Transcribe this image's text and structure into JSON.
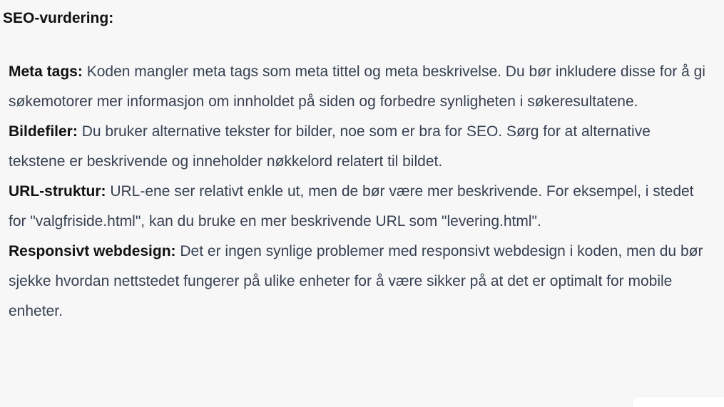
{
  "heading": "SEO-vurdering:",
  "items": [
    {
      "title": "Meta tags:",
      "text": "Koden mangler meta tags som meta tittel og meta beskrivelse. Du bør inkludere disse for å gi søkemotorer mer informasjon om innholdet på siden og forbedre synligheten i søkeresultatene."
    },
    {
      "title": "Bildefiler:",
      "text": "Du bruker alternative tekster for bilder, noe som er bra for SEO. Sørg for at alternative tekstene er beskrivende og inneholder nøkkelord relatert til bildet."
    },
    {
      "title": "URL-struktur:",
      "text": "URL-ene ser relativt enkle ut, men de bør være mer beskrivende. For eksempel, i stedet for \"valgfriside.html\", kan du bruke en mer beskrivende URL som \"levering.html\"."
    },
    {
      "title": "Responsivt webdesign:",
      "text": "Det er ingen synlige problemer med responsivt webdesign i koden, men du bør sjekke hvordan nettstedet fungerer på ulike enheter for å være sikker på at det er optimalt for mobile enheter."
    }
  ]
}
